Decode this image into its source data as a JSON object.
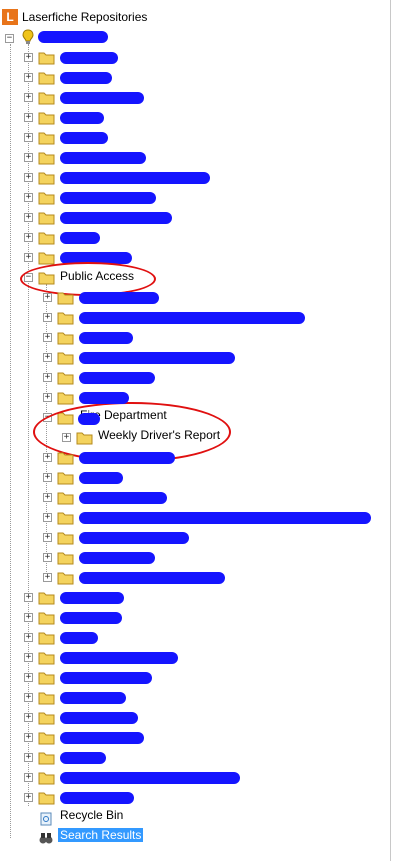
{
  "root": {
    "label": "Laserfiche Repositories",
    "logo_letter": "L"
  },
  "public_access": {
    "label": "Public Access"
  },
  "fire_department": {
    "label": "Fire Department"
  },
  "weekly_report": {
    "label": "Weekly Driver's Report"
  },
  "recycle_bin": {
    "label": "Recycle Bin"
  },
  "search_results": {
    "label": "Search Results"
  },
  "colors": {
    "annotation_circle": "#e01010",
    "redaction": "#1515ff",
    "selection": "#3399ff",
    "logo": "#e8741a"
  }
}
